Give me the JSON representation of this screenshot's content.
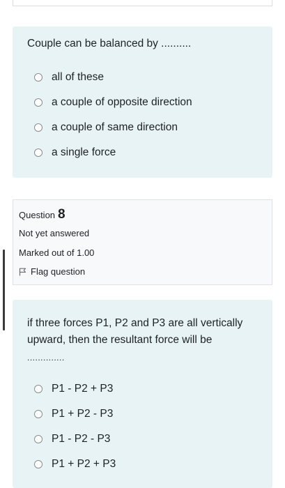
{
  "question7": {
    "text": "Couple can be balanced by ..........",
    "options": [
      {
        "label": "all of these"
      },
      {
        "label": "a couple of opposite direction"
      },
      {
        "label": "a couple of same direction"
      },
      {
        "label": "a single force"
      }
    ]
  },
  "question8": {
    "info": {
      "question_word": "Question",
      "question_number": "8",
      "state": "Not yet answered",
      "grade": "Marked out of 1.00",
      "flag_label": "Flag question"
    },
    "text": "if three forces P1, P2 and P3 are all vertically upward, then the resultant force will be",
    "blank": "..............",
    "options": [
      {
        "label": "P1 - P2 + P3"
      },
      {
        "label": "P1 + P2 - P3"
      },
      {
        "label": "P1 - P2 - P3"
      },
      {
        "label": "P1 + P2 + P3"
      }
    ]
  },
  "colors": {
    "question_bg": "#e7f3f5",
    "info_bg": "#f8f9fa",
    "text": "#1d2125"
  }
}
